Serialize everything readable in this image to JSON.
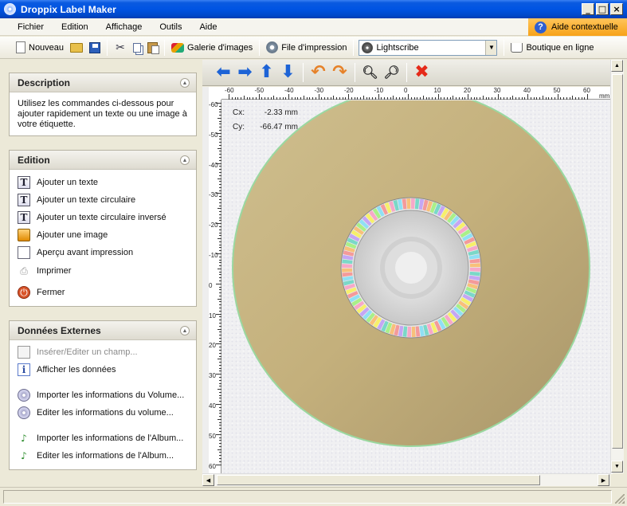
{
  "window": {
    "title": "Droppix Label Maker",
    "minimize": "_",
    "maximize": "□",
    "close": "×"
  },
  "menu": {
    "items": [
      "Fichier",
      "Edition",
      "Affichage",
      "Outils",
      "Aide"
    ],
    "context_help": "Aide contextuelle"
  },
  "toolbar": {
    "new_label": "Nouveau",
    "gallery_label": "Galerie d'images",
    "print_queue_label": "File d'impression",
    "combo_value": "Lightscribe",
    "shop_label": "Boutique en ligne"
  },
  "sidebar": {
    "description": {
      "title": "Description",
      "text": "Utilisez les commandes ci-dessous pour ajouter rapidement un texte ou une image à votre étiquette."
    },
    "edition": {
      "title": "Edition",
      "items": [
        {
          "label": "Ajouter un texte",
          "icon": "text-icon"
        },
        {
          "label": "Ajouter un texte circulaire",
          "icon": "text-icon"
        },
        {
          "label": "Ajouter un texte circulaire inversé",
          "icon": "text-icon"
        },
        {
          "label": "Ajouter une image",
          "icon": "image-icon"
        },
        {
          "label": "Aperçu avant impression",
          "icon": "preview-icon"
        },
        {
          "label": "Imprimer",
          "icon": "printer-icon"
        },
        {
          "label": "Fermer",
          "icon": "close-icon"
        }
      ]
    },
    "external": {
      "title": "Données Externes",
      "items": [
        {
          "label": "Insérer/Editer un champ...",
          "icon": "field-icon",
          "disabled": true
        },
        {
          "label": "Afficher les données",
          "icon": "data-icon"
        },
        {
          "label": "Importer les informations du Volume...",
          "icon": "disc-icon"
        },
        {
          "label": "Editer les informations du volume...",
          "icon": "disc-icon"
        },
        {
          "label": "Importer les informations de l'Album...",
          "icon": "music-note-icon"
        },
        {
          "label": "Editer les informations de l'Album...",
          "icon": "music-note-icon"
        }
      ]
    }
  },
  "canvas": {
    "cursor": {
      "cx_label": "Cx:",
      "cx_value": "-2.33 mm",
      "cy_label": "Cy:",
      "cy_value": "-66.47 mm"
    },
    "ruler_h_ticks": [
      "-60",
      "-50",
      "-40",
      "-30",
      "-20",
      "-10",
      "0",
      "10",
      "20",
      "30",
      "40",
      "50",
      "60"
    ],
    "ruler_h_unit": "mm",
    "ruler_v_ticks": [
      "-60",
      "-50",
      "-40",
      "-30",
      "-20",
      "-10",
      "0",
      "10",
      "20",
      "30",
      "40",
      "50",
      "60"
    ],
    "disc_color": "#c8b47f",
    "disc_edge_color": "#9ad8a0"
  }
}
